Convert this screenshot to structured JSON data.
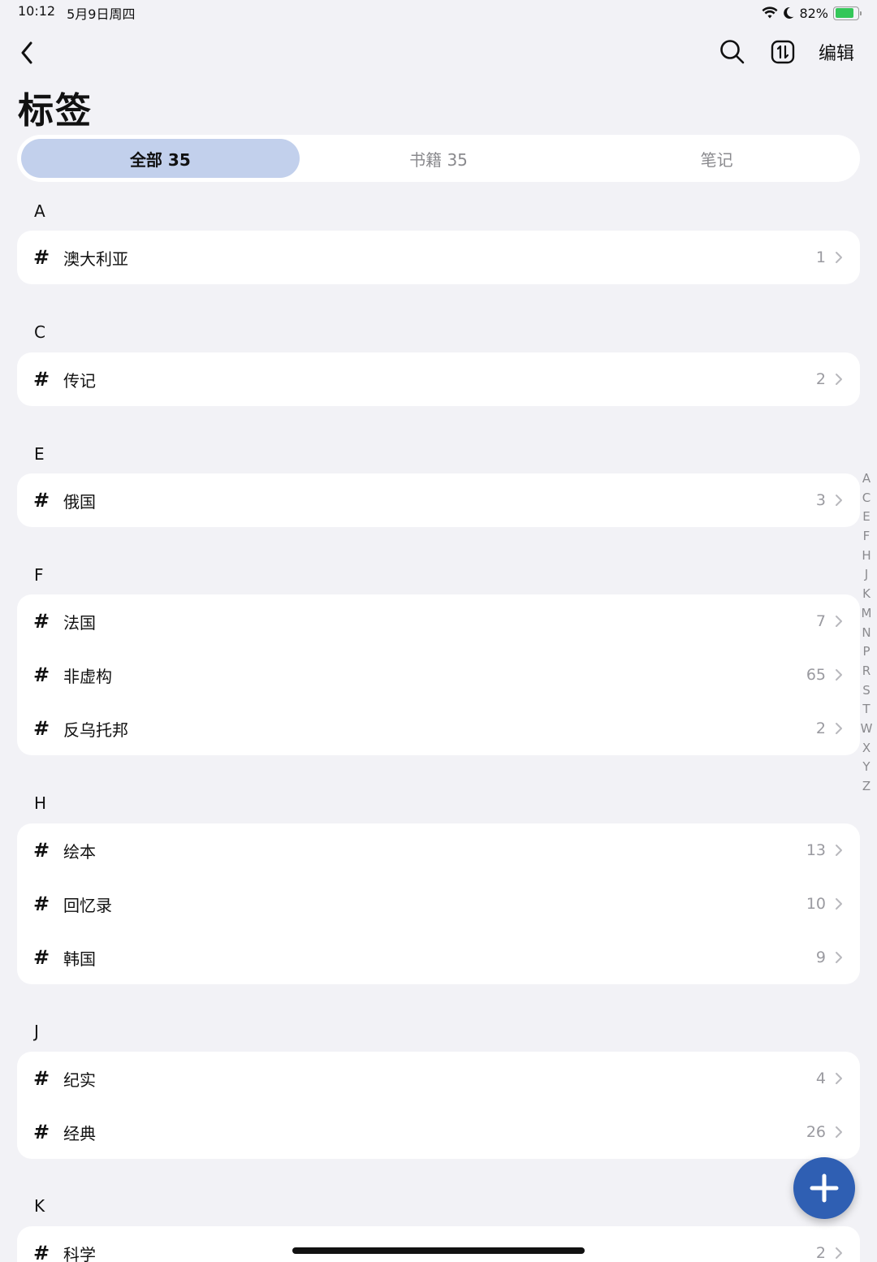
{
  "status": {
    "time": "10:12",
    "date": "5月9日周四",
    "battery": "82%",
    "battery_level": 0.82,
    "battery_color": "#34c759"
  },
  "nav": {
    "back_icon": "chevron-left-icon",
    "search_icon": "search-icon",
    "sort_icon": "sort-icon",
    "edit_label": "编辑"
  },
  "page": {
    "title": "标签"
  },
  "tabs": [
    {
      "label": "全部 35",
      "active": true
    },
    {
      "label": "书籍 35",
      "active": false
    },
    {
      "label": "笔记",
      "active": false
    }
  ],
  "sections": [
    {
      "letter": "A",
      "tags": [
        {
          "name": "澳大利亚",
          "count": "1"
        }
      ]
    },
    {
      "letter": "C",
      "tags": [
        {
          "name": "传记",
          "count": "2"
        }
      ]
    },
    {
      "letter": "E",
      "tags": [
        {
          "name": "俄国",
          "count": "3"
        }
      ]
    },
    {
      "letter": "F",
      "tags": [
        {
          "name": "法国",
          "count": "7"
        },
        {
          "name": "非虚构",
          "count": "65"
        },
        {
          "name": "反乌托邦",
          "count": "2"
        }
      ]
    },
    {
      "letter": "H",
      "tags": [
        {
          "name": "绘本",
          "count": "13"
        },
        {
          "name": "回忆录",
          "count": "10"
        },
        {
          "name": "韩国",
          "count": "9"
        }
      ]
    },
    {
      "letter": "J",
      "tags": [
        {
          "name": "纪实",
          "count": "4"
        },
        {
          "name": "经典",
          "count": "26"
        }
      ]
    },
    {
      "letter": "K",
      "tags": [
        {
          "name": "科学",
          "count": "2"
        }
      ]
    }
  ],
  "index_letters": [
    "A",
    "C",
    "E",
    "F",
    "H",
    "J",
    "K",
    "M",
    "N",
    "P",
    "R",
    "S",
    "T",
    "W",
    "X",
    "Y",
    "Z"
  ],
  "hash_symbol": "#",
  "fab_icon": "plus-icon",
  "colors": {
    "accent": "#2f5fb3",
    "tab_active": "#c2d0ec"
  }
}
